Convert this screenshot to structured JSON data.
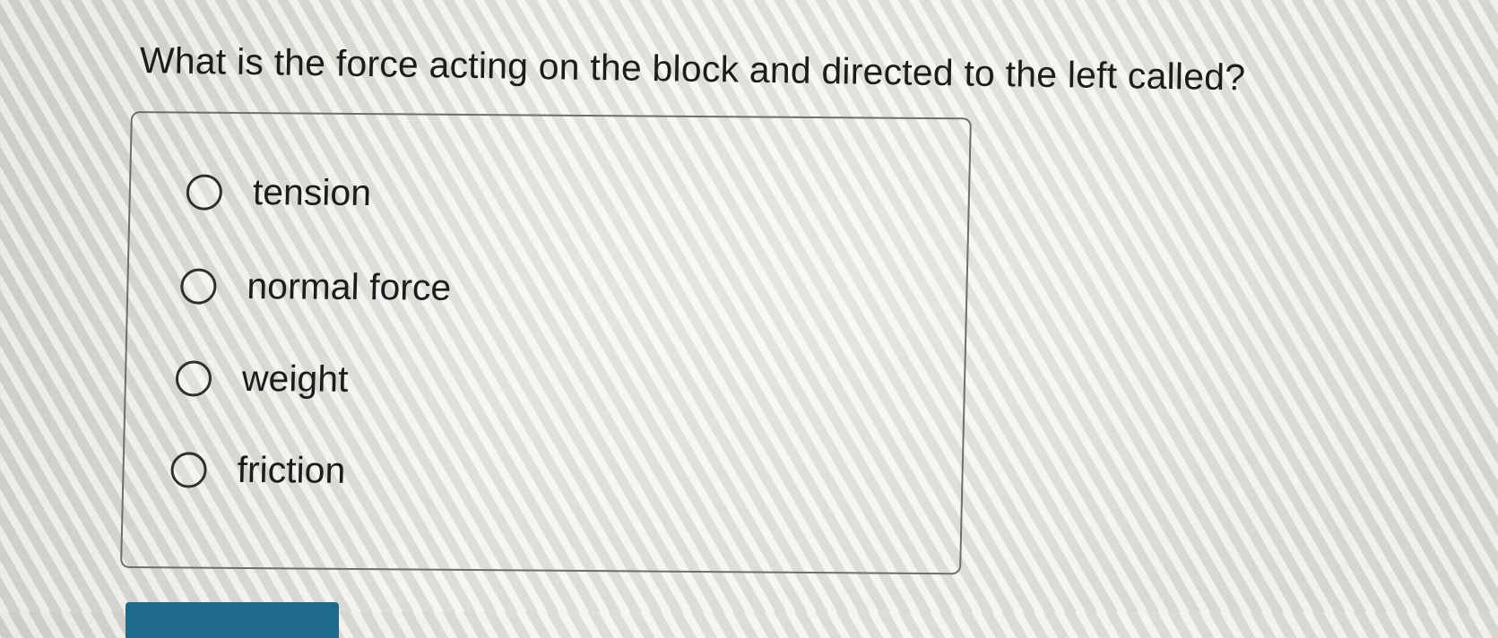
{
  "question": {
    "text": "What is the force acting on the block and directed to the left called?"
  },
  "options": [
    {
      "label": "tension",
      "selected": false
    },
    {
      "label": "normal force",
      "selected": false
    },
    {
      "label": "weight",
      "selected": false
    },
    {
      "label": "friction",
      "selected": false
    }
  ],
  "colors": {
    "text": "#1c1c1c",
    "box_border": "#6e6e6a",
    "submit_button": "#1f6b8f"
  }
}
